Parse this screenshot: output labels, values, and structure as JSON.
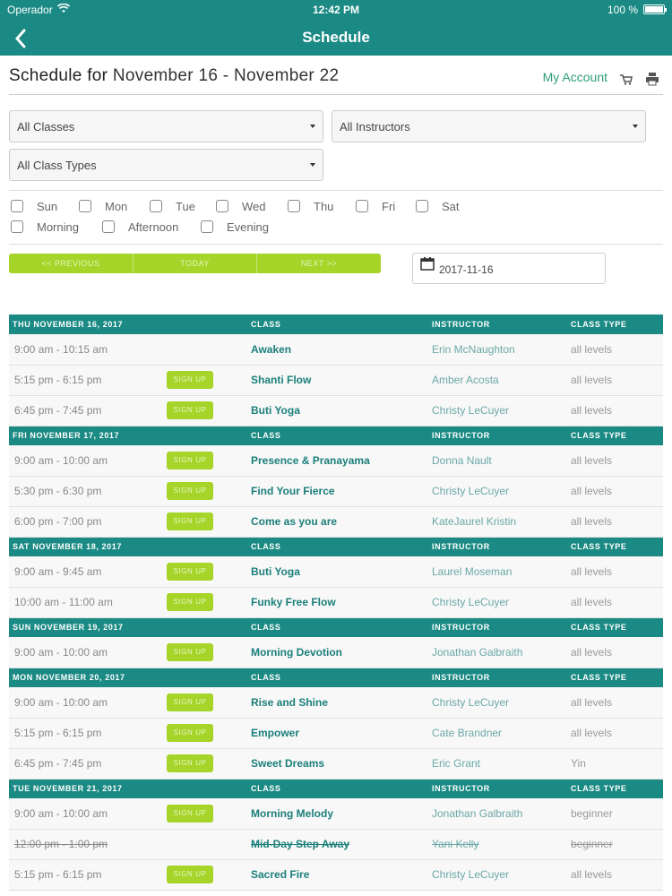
{
  "status_bar": {
    "carrier": "Operador",
    "time": "12:42 PM",
    "battery": "100 %"
  },
  "nav": {
    "title": "Schedule",
    "back_icon": "chevron-left-icon"
  },
  "header": {
    "title_prefix": "Schedule for",
    "title_range": "November 16 - November 22",
    "account_link": "My Account"
  },
  "filters": {
    "classes": "All Classes",
    "instructors": "All Instructors",
    "class_types": "All Class Types",
    "days": [
      "Sun",
      "Mon",
      "Tue",
      "Wed",
      "Thu",
      "Fri",
      "Sat"
    ],
    "times": [
      "Morning",
      "Afternoon",
      "Evening"
    ]
  },
  "pager": {
    "previous": "<< PREVIOUS",
    "today": "TODAY",
    "next": "NEXT >>"
  },
  "date_value": "2017-11-16",
  "columns": {
    "class": "CLASS",
    "instructor": "INSTRUCTOR",
    "class_type": "CLASS TYPE"
  },
  "signup_label": "SIGN UP",
  "colors": {
    "teal": "#1b8a84",
    "lime": "#a6d428",
    "link_green": "#2c9c7a"
  },
  "days": [
    {
      "label": "THU NOVEMBER 16, 2017",
      "rows": [
        {
          "time": "9:00 am - 10:15 am",
          "signup": false,
          "class": "Awaken",
          "instructor": "Erin McNaughton",
          "type": "all levels"
        },
        {
          "time": "5:15 pm - 6:15 pm",
          "signup": true,
          "class": "Shanti Flow",
          "instructor": "Amber Acosta",
          "type": "all levels"
        },
        {
          "time": "6:45 pm - 7:45 pm",
          "signup": true,
          "class": "Buti Yoga",
          "instructor": "Christy LeCuyer",
          "type": "all levels"
        }
      ]
    },
    {
      "label": "FRI NOVEMBER 17, 2017",
      "rows": [
        {
          "time": "9:00 am - 10:00 am",
          "signup": true,
          "class": "Presence & Pranayama",
          "instructor": "Donna Nault",
          "type": "all levels"
        },
        {
          "time": "5:30 pm - 6:30 pm",
          "signup": true,
          "class": "Find Your Fierce",
          "instructor": "Christy LeCuyer",
          "type": "all levels"
        },
        {
          "time": "6:00 pm - 7:00 pm",
          "signup": true,
          "class": "Come as you are",
          "instructor": "KateJaurel Kristin",
          "type": "all levels"
        }
      ]
    },
    {
      "label": "SAT NOVEMBER 18, 2017",
      "rows": [
        {
          "time": "9:00 am - 9:45 am",
          "signup": true,
          "class": "Buti Yoga",
          "instructor": "Laurel Moseman",
          "type": "all levels"
        },
        {
          "time": "10:00 am - 11:00 am",
          "signup": true,
          "class": "Funky Free Flow",
          "instructor": "Christy LeCuyer",
          "type": "all levels"
        }
      ]
    },
    {
      "label": "SUN NOVEMBER 19, 2017",
      "rows": [
        {
          "time": "9:00 am - 10:00 am",
          "signup": true,
          "class": "Morning Devotion",
          "instructor": "Jonathan Galbraith",
          "type": "all levels"
        }
      ]
    },
    {
      "label": "MON NOVEMBER 20, 2017",
      "rows": [
        {
          "time": "9:00 am - 10:00 am",
          "signup": true,
          "class": "Rise and Shine",
          "instructor": "Christy LeCuyer",
          "type": "all levels"
        },
        {
          "time": "5:15 pm - 6:15 pm",
          "signup": true,
          "class": "Empower",
          "instructor": "Cate Brandner",
          "type": "all levels"
        },
        {
          "time": "6:45 pm - 7:45 pm",
          "signup": true,
          "class": "Sweet Dreams",
          "instructor": "Eric Grant",
          "type": "Yin"
        }
      ]
    },
    {
      "label": "TUE NOVEMBER 21, 2017",
      "rows": [
        {
          "time": "9:00 am - 10:00 am",
          "signup": true,
          "class": "Morning Melody",
          "instructor": "Jonathan Galbraith",
          "type": "beginner"
        },
        {
          "time": "12:00 pm - 1:00 pm",
          "signup": false,
          "cancelled": true,
          "class": "Mid-Day Step Away",
          "instructor": "Yani Kelly",
          "type": "beginner"
        },
        {
          "time": "5:15 pm - 6:15 pm",
          "signup": true,
          "class": "Sacred Fire",
          "instructor": "Christy LeCuyer",
          "type": "all levels"
        }
      ]
    }
  ]
}
